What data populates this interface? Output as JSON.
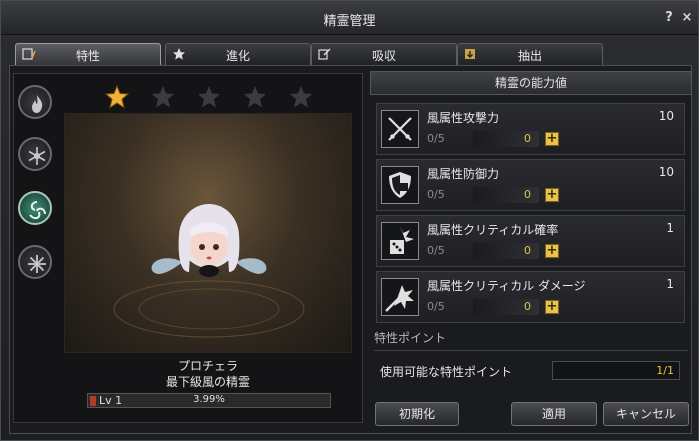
{
  "window": {
    "title": "精霊管理",
    "help": "?",
    "close": "×"
  },
  "tabs": [
    {
      "label": "特性",
      "icon": "traits-icon"
    },
    {
      "label": "進化",
      "icon": "star-icon"
    },
    {
      "label": "吸収",
      "icon": "absorb-icon"
    },
    {
      "label": "抽出",
      "icon": "extract-icon"
    }
  ],
  "element_buttons": [
    {
      "name": "fire",
      "icon": "fire-icon"
    },
    {
      "name": "water",
      "icon": "snowflake-icon"
    },
    {
      "name": "wind",
      "icon": "wind-icon",
      "active": true
    },
    {
      "name": "light",
      "icon": "burst-icon"
    }
  ],
  "stars": {
    "filled": 1,
    "total": 5
  },
  "character": {
    "name": "プロチェラ",
    "title": "最下級風の精霊",
    "level": "Lv 1",
    "exp_percent": "3.99%"
  },
  "stats_panel": {
    "header": "精霊の能力値",
    "stats": [
      {
        "name": "風属性攻撃力",
        "value": "10",
        "points": "0/5",
        "current": "0",
        "icon": "crossed-swords-icon"
      },
      {
        "name": "風属性防御力",
        "value": "10",
        "points": "0/5",
        "current": "0",
        "icon": "shield-icon"
      },
      {
        "name": "風属性クリティカル確率",
        "value": "1",
        "points": "0/5",
        "current": "0",
        "icon": "dice-burst-icon"
      },
      {
        "name": "風属性クリティカル ダメージ",
        "value": "1",
        "points": "0/5",
        "current": "0",
        "icon": "sword-burst-icon"
      }
    ],
    "trait_section": "特性ポイント",
    "available_label": "使用可能な特性ポイント",
    "available_value": "1/1"
  },
  "buttons": {
    "reset": "初期化",
    "apply": "適用",
    "cancel": "キャンセル"
  },
  "colors": {
    "accent": "#e8c24a",
    "active_element": "#3f8f7a"
  }
}
